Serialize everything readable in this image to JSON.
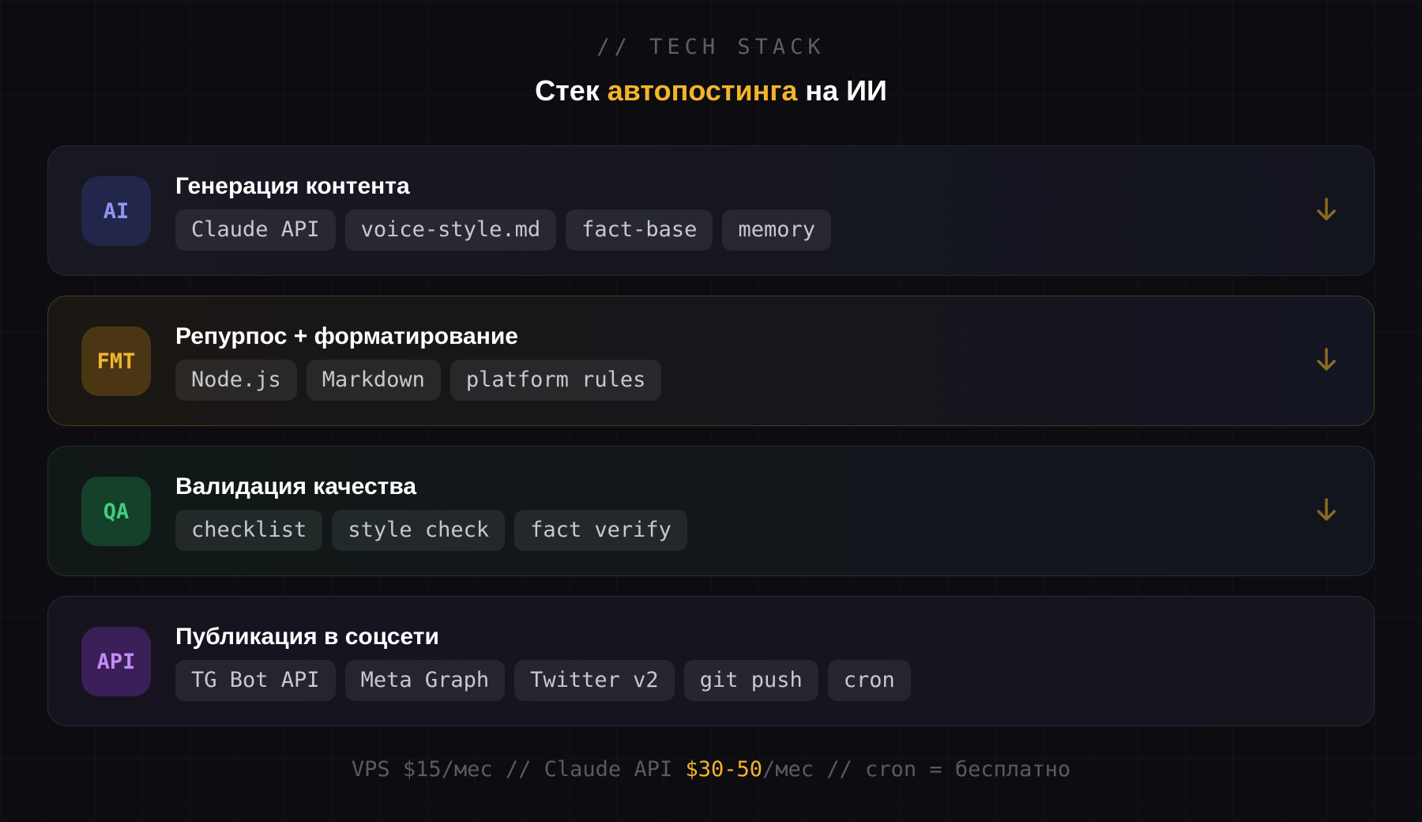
{
  "header": {
    "overline": "// TECH STACK",
    "title_prefix": "Стек ",
    "title_accent": "автопостинга",
    "title_suffix": " на ИИ"
  },
  "colors": {
    "accent": "#f4b428",
    "ai": "#8f96f4",
    "fmt": "#f1b530",
    "qa": "#3ecf7f",
    "api": "#c48cf6"
  },
  "cards": [
    {
      "badge": "AI",
      "title": "Генерация контента",
      "tags": [
        "Claude API",
        "voice-style.md",
        "fact-base",
        "memory"
      ],
      "has_arrow": true
    },
    {
      "badge": "FMT",
      "title": "Репурпос + форматирование",
      "tags": [
        "Node.js",
        "Markdown",
        "platform rules"
      ],
      "has_arrow": true
    },
    {
      "badge": "QA",
      "title": "Валидация качества",
      "tags": [
        "checklist",
        "style check",
        "fact verify"
      ],
      "has_arrow": true
    },
    {
      "badge": "API",
      "title": "Публикация в соцсети",
      "tags": [
        "TG Bot API",
        "Meta Graph",
        "Twitter v2",
        "git push",
        "cron"
      ],
      "has_arrow": false
    }
  ],
  "footer": {
    "part1": "VPS $15/мес // Claude API ",
    "highlight": "$30-50",
    "part2": "/мес // cron = бесплатно"
  }
}
